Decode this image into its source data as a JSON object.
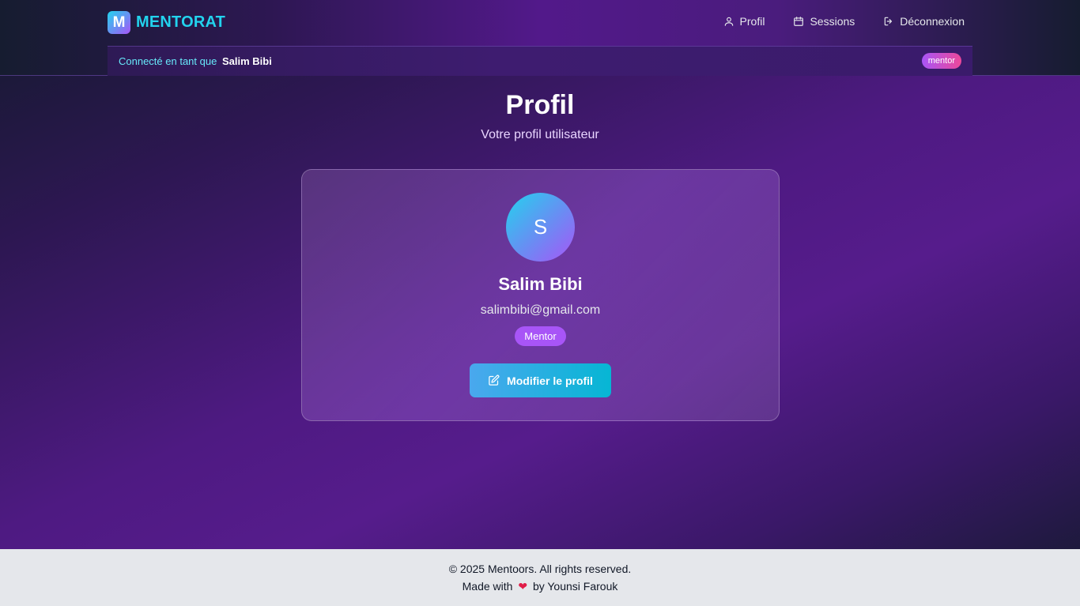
{
  "header": {
    "brand_letter": "M",
    "brand_name": "MENTORAT",
    "nav": [
      {
        "label": "Profil",
        "icon": "user-icon"
      },
      {
        "label": "Sessions",
        "icon": "calendar-icon"
      },
      {
        "label": "Déconnexion",
        "icon": "logout-icon"
      }
    ],
    "session": {
      "prefix": "Connecté en tant que",
      "user": "Salim Bibi",
      "role": "mentor"
    }
  },
  "main": {
    "title": "Profil",
    "subtitle": "Votre profil utilisateur",
    "profile": {
      "initial": "S",
      "name": "Salim Bibi",
      "email": "salimbibi@gmail.com",
      "role": "Mentor",
      "edit_label": "Modifier le profil",
      "edit_icon": "edit-icon"
    }
  },
  "footer": {
    "copyright": "© 2025 Mentoors. All rights reserved.",
    "made_with": "Made with",
    "heart": "❤",
    "by": "by Younsi Farouk"
  },
  "colors": {
    "accent_cyan": "#22d3ee",
    "accent_purple": "#a855f7",
    "accent_pink": "#ec4899",
    "footer_bg": "#e5e7eb"
  }
}
